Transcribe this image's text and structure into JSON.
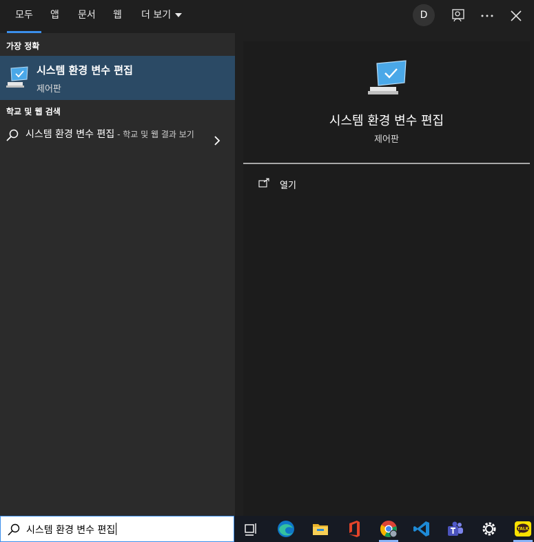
{
  "tabs": [
    {
      "label": "모두",
      "active": true
    },
    {
      "label": "앱"
    },
    {
      "label": "문서"
    },
    {
      "label": "웹"
    },
    {
      "label": "더 보기"
    }
  ],
  "account": {
    "initial": "D"
  },
  "left": {
    "best_match_heading": "가장 정확",
    "best_match": {
      "title": "시스템 환경 변수 편집",
      "subtitle": "제어판",
      "icon": "system-monitor-icon"
    },
    "web_heading": "학교 및 웹 검색",
    "web_result": {
      "query": "시스템 환경 변수 편집",
      "suffix": " - 학교 및 웹 결과 보기",
      "icon": "search-icon"
    }
  },
  "preview": {
    "title": "시스템 환경 변수 편집",
    "subtitle": "제어판",
    "actions": [
      {
        "label": "열기",
        "icon": "open-icon"
      }
    ]
  },
  "taskbar": {
    "search_value": "시스템 환경 변수 편집",
    "apps": [
      {
        "name": "task-view-icon"
      },
      {
        "name": "edge-icon"
      },
      {
        "name": "file-explorer-icon"
      },
      {
        "name": "office-icon"
      },
      {
        "name": "chrome-icon",
        "active": true
      },
      {
        "name": "vscode-icon"
      },
      {
        "name": "teams-icon"
      },
      {
        "name": "settings-icon"
      },
      {
        "name": "kakaotalk-icon",
        "label": "TALK",
        "active": true
      }
    ]
  },
  "colors": {
    "accent": "#3b8eea",
    "best_match_bg": "#2b4a65",
    "panel_left": "#2b2b2b",
    "panel_right": "#1c1c1c"
  }
}
